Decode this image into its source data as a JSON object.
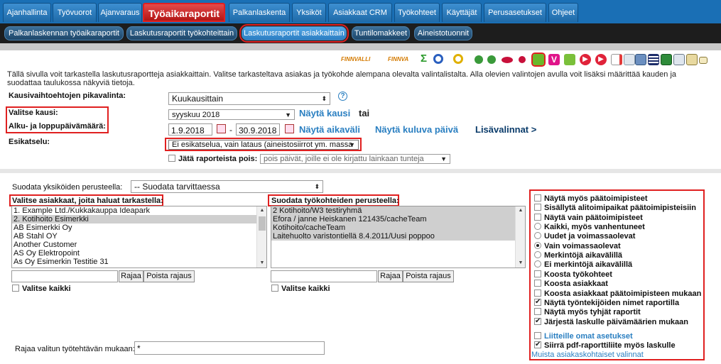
{
  "nav": {
    "tabs": [
      {
        "label": "Ajanhallinta"
      },
      {
        "label": "Työvuorot"
      },
      {
        "label": "Ajanvaraus"
      },
      {
        "label": "Työaikaraportit"
      },
      {
        "label": "Palkanlaskenta"
      },
      {
        "label": "Yksiköt"
      },
      {
        "label": "Asiakkaat CRM"
      },
      {
        "label": "Työkohteet"
      },
      {
        "label": "Käyttäjät"
      },
      {
        "label": "Perusasetukset"
      },
      {
        "label": "Ohjeet"
      }
    ],
    "active_index": 3
  },
  "subnav": {
    "tabs": [
      {
        "label": "Palkanlaskennan työaikaraportit"
      },
      {
        "label": "Laskutusraportit työkohteittain"
      },
      {
        "label": "Laskutusraportit asiakkaittain"
      },
      {
        "label": "Tuntilomakkeet"
      },
      {
        "label": "Aineistotuonnit"
      }
    ],
    "active_index": 2
  },
  "toolbar": {
    "finnvalli_1": "FINNVALLI",
    "finnvalli_2": "FINNVA"
  },
  "intro": "Tällä sivulla voit tarkastella laskutusraportteja asiakkaittain. Valitse tarkasteltava asiakas ja työkohde alempana olevalta valintalistalta. Alla olevien valintojen avulla voit lisäksi määrittää kauden ja suodattaa taulukossa näkyviä tietoja.",
  "period": {
    "quick_label": "Kausivaihtoehtojen pikavalinta:",
    "quick_value": "Kuukausittain",
    "help": "?",
    "choose_label": "Valitse kausi:",
    "choose_value": "syyskuu 2018",
    "show_period": "Näytä kausi",
    "or": "tai",
    "range_label": "Alku- ja loppupäivämäärä:",
    "start": "1.9.2018",
    "dash": "-",
    "end": "30.9.2018",
    "show_range": "Näytä aikaväli",
    "show_current": "Näytä kuluva päivä",
    "more": "Lisävalinnat >"
  },
  "preview": {
    "label": "Esikatselu:",
    "value": "Ei esikatselua, vain lataus (aineistosiirrot ym. massa",
    "exclude_label": "Jätä raporteista pois:",
    "exclude_placeholder": "pois päivät, joille ei ole kirjattu lainkaan tunteja"
  },
  "unit_filter": {
    "label": "Suodata yksiköiden perusteella:",
    "value": "-- Suodata tarvittaessa"
  },
  "customers": {
    "label": "Valitse asiakkaat, joita haluat tarkastella:",
    "items": [
      "1. Example Ltd./Kukkakauppa Ideapark",
      "2. Kotihoito Esimerkki",
      "AB Esimerkki Oy",
      "AB Stahl OY",
      "Another Customer",
      "AS Oy Elektropoint",
      "As Oy Esimerkin Testitie 31"
    ],
    "selected_index": 1,
    "limit_button": "Rajaa",
    "clear_button": "Poista rajaus",
    "select_all": "Valitse kaikki"
  },
  "workitems": {
    "label": "Suodata työkohteiden perusteella:",
    "items": [
      "2 Kotihoito/W3 testiryhmä",
      "Efora / janne Heiskanen 121435/cacheTeam",
      "Kotihoito/cacheTeam",
      "Laitehuolto varistontiellä 8.4.2011/Uusi poppoo"
    ],
    "limit_button": "Rajaa",
    "clear_button": "Poista rajaus",
    "select_all": "Valitse kaikki"
  },
  "task_filter": {
    "label": "Rajaa valitun työtehtävän mukaan:",
    "value": "*"
  },
  "options": [
    {
      "type": "checkbox",
      "label": "Näytä myös päätoimipisteet",
      "checked": false
    },
    {
      "type": "checkbox",
      "label": "Sisällytä alitoimipaikat päätoimipisteisiin",
      "checked": false
    },
    {
      "type": "checkbox",
      "label": "Näytä vain päätoimipisteet",
      "checked": false
    },
    {
      "type": "radio",
      "label": "Kaikki, myös vanhentuneet",
      "checked": false
    },
    {
      "type": "radio",
      "label": "Uudet ja voimassaolevat",
      "checked": false
    },
    {
      "type": "radio",
      "label": "Vain voimassaolevat",
      "checked": true
    },
    {
      "type": "radio",
      "label": "Merkintöjä aikavälillä",
      "checked": false
    },
    {
      "type": "radio",
      "label": "Ei merkintöjä aikavälillä",
      "checked": false
    },
    {
      "type": "checkbox",
      "label": "Koosta työkohteet",
      "checked": false
    },
    {
      "type": "checkbox",
      "label": "Koosta asiakkaat",
      "checked": false
    },
    {
      "type": "checkbox",
      "label": "Koosta asiakkaat päätoimipisteen mukaan",
      "checked": false
    },
    {
      "type": "checkbox",
      "label": "Näytä työntekijöiden nimet raportilla",
      "checked": true
    },
    {
      "type": "checkbox",
      "label": "Näytä myös tyhjät raportit",
      "checked": false
    },
    {
      "type": "checkbox",
      "label": "Järjestä laskulle päivämäärien mukaan",
      "checked": true
    }
  ],
  "attachments": {
    "own_settings": "Liitteille omat asetukset",
    "own_settings_checked": false,
    "move_pdf": "Siirrä pdf-raporttiliite myös laskulle",
    "move_pdf_checked": true,
    "remember": "Muista asiakaskohtaiset valinnat"
  }
}
